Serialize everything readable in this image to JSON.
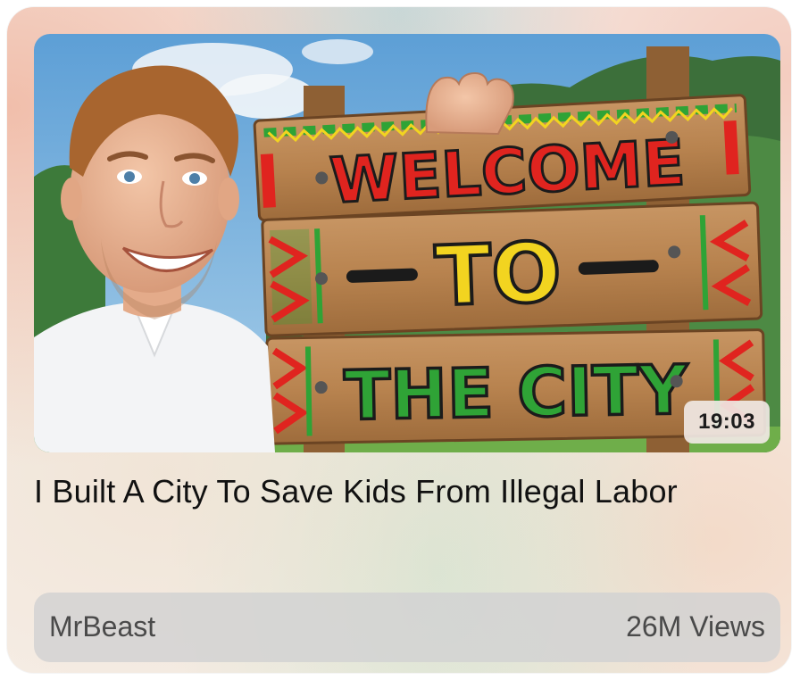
{
  "video": {
    "duration": "19:03",
    "title": "I Built A City To Save Kids From Illegal Labor",
    "channel": "MrBeast",
    "views": "26M Views",
    "thumbnail_sign": {
      "line1": "WELCOME",
      "line2": "TO",
      "line3": "THE CITY"
    }
  },
  "colors": {
    "sign_red": "#e0241f",
    "sign_yellow": "#f2d420",
    "sign_green": "#2fa336",
    "wood": "#b98552"
  }
}
